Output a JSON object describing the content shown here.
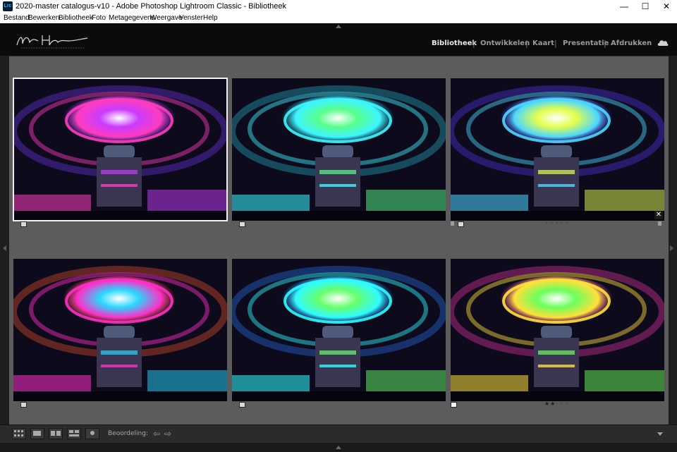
{
  "window": {
    "title": "2020-master catalogus-v10 - Adobe Photoshop Lightroom Classic - Bibliotheek",
    "app_icon_text": "Lrc",
    "minimize": "—",
    "maximize": "☐",
    "close": "✕"
  },
  "menu": [
    "Bestand",
    "Bewerken",
    "Bibliotheek",
    "Foto",
    "Metagegevens",
    "Weergave",
    "Venster",
    "Help"
  ],
  "modules": {
    "items": [
      "Bibliotheek",
      "Ontwikkelen",
      "Kaart",
      "Presentatie",
      "Afdrukken"
    ],
    "active": "Bibliotheek",
    "separator": "|"
  },
  "grid": {
    "thumbnails": [
      {
        "selected": true,
        "palette": [
          "#ff3cbe",
          "#c93bff",
          "#7b3cff"
        ],
        "stars": "",
        "close": false,
        "flag_style": "unflagged"
      },
      {
        "selected": false,
        "palette": [
          "#3df5ff",
          "#57ff8a",
          "#29c3d8"
        ],
        "stars": "",
        "close": false,
        "flag_style": "unflagged"
      },
      {
        "selected": false,
        "palette": [
          "#4bd7ff",
          "#e5ff4b",
          "#5d3cff"
        ],
        "stars": "· · · · ·",
        "close": true,
        "close_symbol": "✕",
        "flag_style": "unflagged"
      },
      {
        "selected": false,
        "palette": [
          "#ff2fc8",
          "#27d7ff",
          "#ff5a2f"
        ],
        "stars": "",
        "close": false,
        "flag_style": "unflagged"
      },
      {
        "selected": false,
        "palette": [
          "#2ffbff",
          "#67ff6b",
          "#2a7bff"
        ],
        "stars": "",
        "close": false,
        "flag_style": "unflagged"
      },
      {
        "selected": false,
        "palette": [
          "#ffe03b",
          "#6bff5a",
          "#ff3bb4"
        ],
        "stars": "★★· · ·",
        "close": false,
        "flag_style": "flagged"
      }
    ]
  },
  "toolbar": {
    "rating_label": "Beoordeling:",
    "prev_arrow": "⇦",
    "next_arrow": "⇨"
  }
}
